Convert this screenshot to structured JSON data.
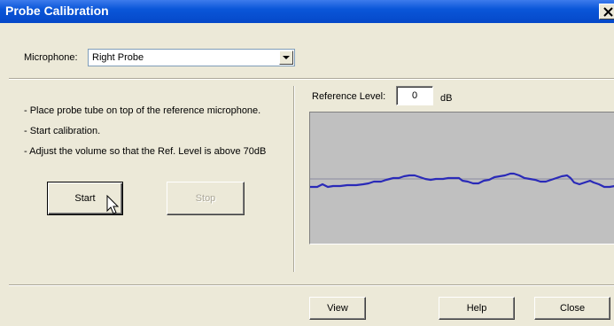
{
  "window": {
    "title": "Probe Calibration",
    "close_label": "×"
  },
  "microphone": {
    "label": "Microphone:",
    "value": "Right Probe"
  },
  "instructions": [
    "- Place probe tube on top of the reference microphone.",
    "- Start calibration.",
    "- Adjust the volume so that the Ref. Level is above 70dB"
  ],
  "buttons": {
    "start": "Start",
    "stop": "Stop",
    "view": "View",
    "help": "Help",
    "close": "Close"
  },
  "reference": {
    "label": "Reference Level:",
    "value": "0",
    "unit": "dB"
  },
  "colors": {
    "titlebar": "#0a56d8",
    "waveform": "#2a2ab8",
    "plot_background": "#c0c0c0"
  }
}
